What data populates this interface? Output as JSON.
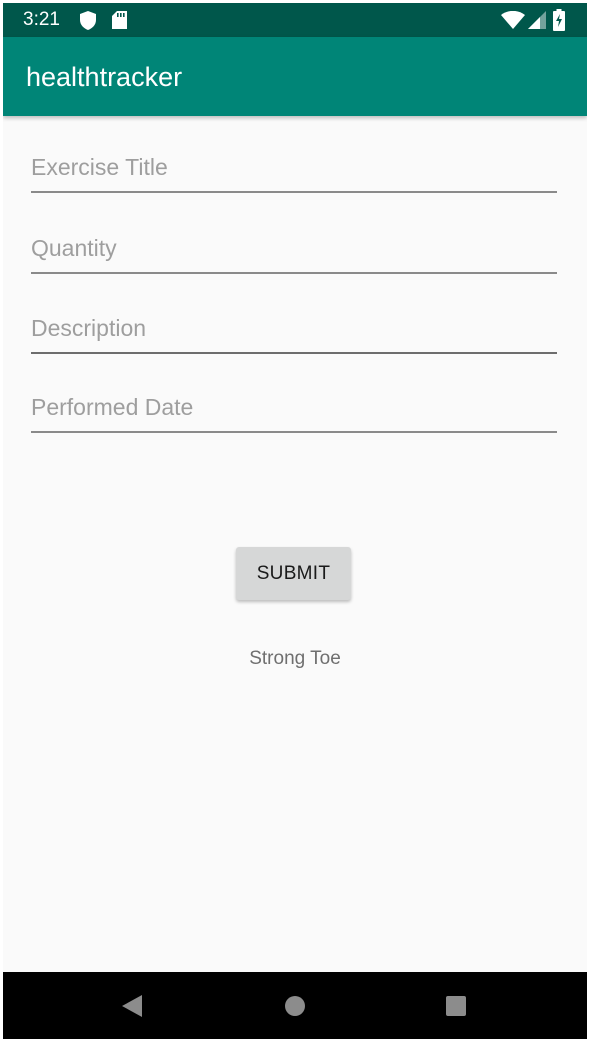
{
  "status_bar": {
    "time": "3:21",
    "left_icons": [
      "shield-icon",
      "sd-card-icon"
    ],
    "right_icons": [
      "wifi-icon",
      "signal-icon",
      "battery-charging-icon"
    ]
  },
  "app_bar": {
    "title": "healthtracker"
  },
  "form": {
    "exercise_title": {
      "placeholder": "Exercise Title",
      "value": ""
    },
    "quantity": {
      "placeholder": "Quantity",
      "value": ""
    },
    "description": {
      "placeholder": "Description",
      "value": ""
    },
    "performed_date": {
      "placeholder": "Performed Date",
      "value": ""
    },
    "submit_label": "SUBMIT"
  },
  "result": {
    "text": "Strong Toe"
  },
  "nav_bar": {
    "buttons": [
      "back-icon",
      "home-icon",
      "recents-icon"
    ]
  },
  "colors": {
    "status_bar": "#00574b",
    "app_bar": "#008577",
    "background": "#fafafa",
    "button": "#d6d7d7",
    "nav_bar": "#000000"
  }
}
